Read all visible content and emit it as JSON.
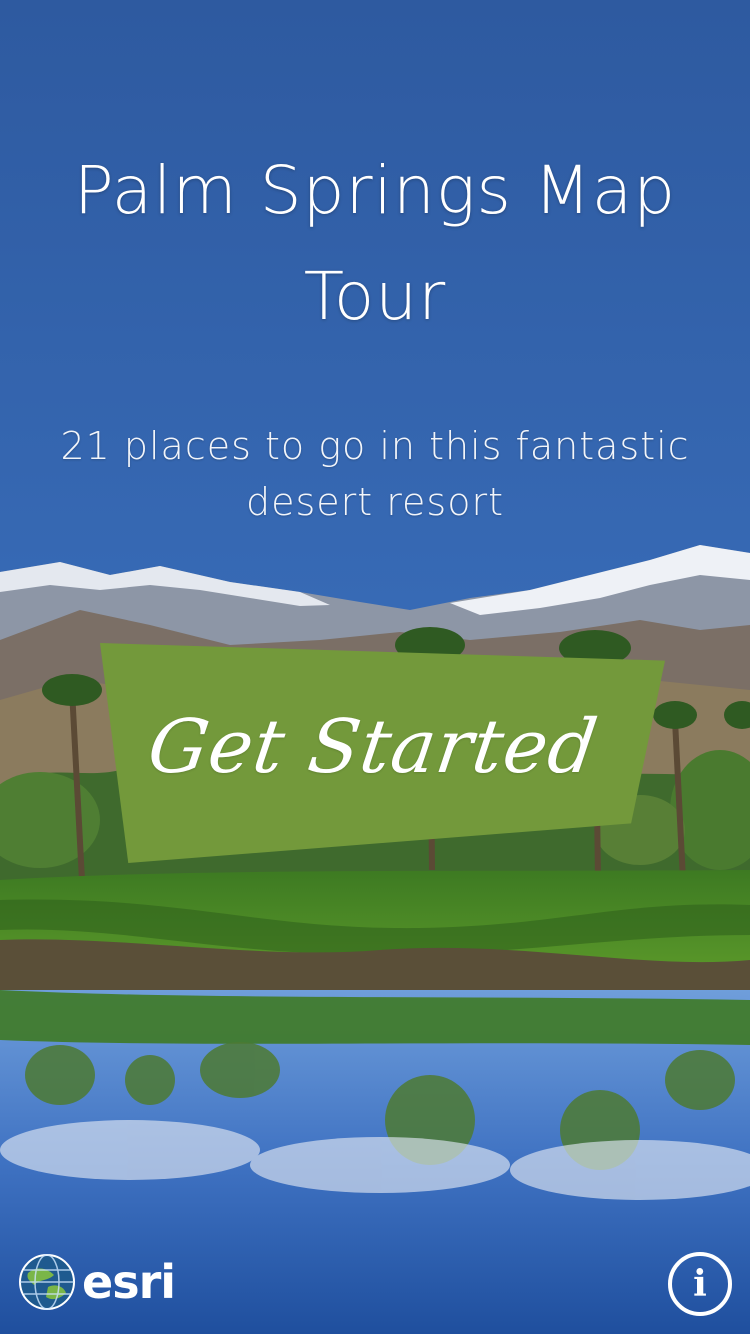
{
  "intro": {
    "title_line1": "Palm Springs Map",
    "title_line2": "Tour",
    "subtitle_line1": "21 places to go in this fantastic",
    "subtitle_line2": "desert resort"
  },
  "actions": {
    "get_started_label": "Get Started",
    "info_label": "i"
  },
  "branding": {
    "logo_text": "esri",
    "logo_icon": "globe-icon"
  },
  "colors": {
    "sky": "#2f5fa6",
    "button_green": "#73993b",
    "text": "#ffffff"
  }
}
